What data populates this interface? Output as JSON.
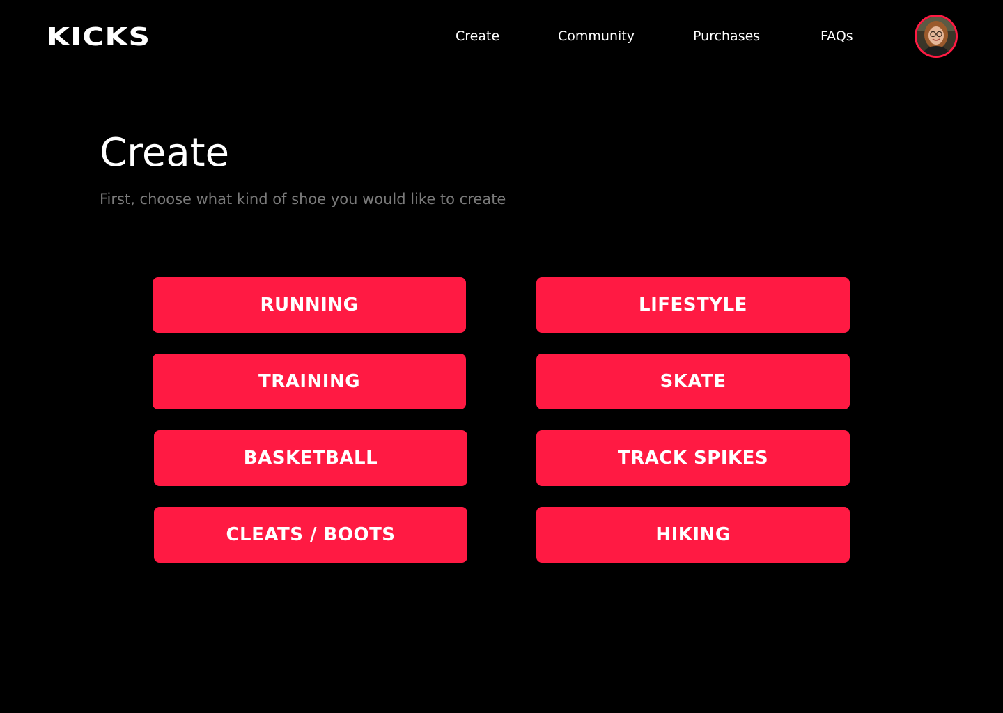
{
  "brand": {
    "logo_text": "KICKS",
    "accent_color": "#ff1a43",
    "background_color": "#000000"
  },
  "nav": {
    "items": [
      {
        "label": "Create"
      },
      {
        "label": "Community"
      },
      {
        "label": "Purchases"
      },
      {
        "label": "FAQs"
      }
    ],
    "avatar_icon": "user-avatar-photo"
  },
  "main": {
    "title": "Create",
    "subtitle": "First, choose what kind of shoe you would like to create",
    "shoe_types": [
      {
        "label": "RUNNING"
      },
      {
        "label": "LIFESTYLE"
      },
      {
        "label": "TRAINING"
      },
      {
        "label": "SKATE"
      },
      {
        "label": "BASKETBALL"
      },
      {
        "label": "TRACK SPIKES"
      },
      {
        "label": "CLEATS / BOOTS"
      },
      {
        "label": "HIKING"
      }
    ]
  }
}
